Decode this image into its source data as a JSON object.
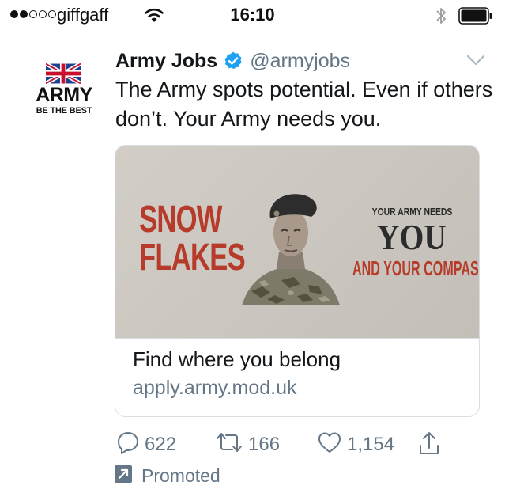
{
  "status_bar": {
    "carrier": "giffgaff",
    "time": "16:10",
    "signal_strength": 2,
    "signal_max": 5,
    "icons": [
      "wifi-icon",
      "bluetooth-icon",
      "battery-icon"
    ]
  },
  "tweet": {
    "author_name": "Army Jobs",
    "verified": true,
    "handle": "@armyjobs",
    "avatar": {
      "logo_text": "ARMY",
      "logo_subtext": "BE THE BEST"
    },
    "text": "The Army spots potential. Even if others don’t. Your Army needs you.",
    "card": {
      "image_text": {
        "headline_line1": "SNOW",
        "headline_line2": "FLAKES",
        "top_line": "YOUR ARMY NEEDS",
        "big_word": "YOU",
        "bottom_line": "AND YOUR COMPASSION"
      },
      "title": "Find where you belong",
      "url": "apply.army.mod.uk"
    },
    "actions": {
      "replies": "622",
      "retweets": "166",
      "likes": "1,154"
    },
    "promoted_label": "Promoted"
  },
  "colors": {
    "verified_blue": "#1da1f2",
    "secondary_text": "#657786",
    "poster_red": "#b63b2b",
    "poster_background": "#cfcbc4"
  }
}
